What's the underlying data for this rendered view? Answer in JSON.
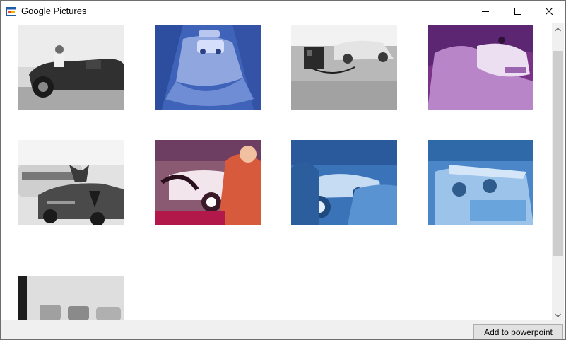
{
  "window": {
    "title": "Google Pictures",
    "app_icon": "windows-form-icon"
  },
  "controls": [
    "minimize-icon",
    "maximize-icon",
    "close-icon"
  ],
  "gallery": {
    "thumbnails": [
      {
        "description": "black-and-white woman in convertible sports car",
        "tint": "#9a9a9a"
      },
      {
        "description": "blue-tinted convertible splashing through water",
        "tint": "#3f63b8"
      },
      {
        "description": "black-and-white convertible with camera equipment",
        "tint": "#8d8d8d"
      },
      {
        "description": "purple-tinted corvette splashing through water",
        "tint": "#8b3d9a"
      },
      {
        "description": "black-and-white dog in convertible alfa romeo",
        "tint": "#9f9f9f"
      },
      {
        "description": "purple-tinted driver at steering wheel with white convertible",
        "tint": "#9b3058"
      },
      {
        "description": "blue-tinted driver at steering wheel with white convertible",
        "tint": "#3a73b8"
      },
      {
        "description": "blue-tinted couple in convertible",
        "tint": "#4a86c8"
      },
      {
        "description": "black-and-white street with parked cars",
        "tint": "#b5b5b5"
      }
    ]
  },
  "buttons": {
    "add_to_powerpoint": "Add to powerpoint"
  }
}
